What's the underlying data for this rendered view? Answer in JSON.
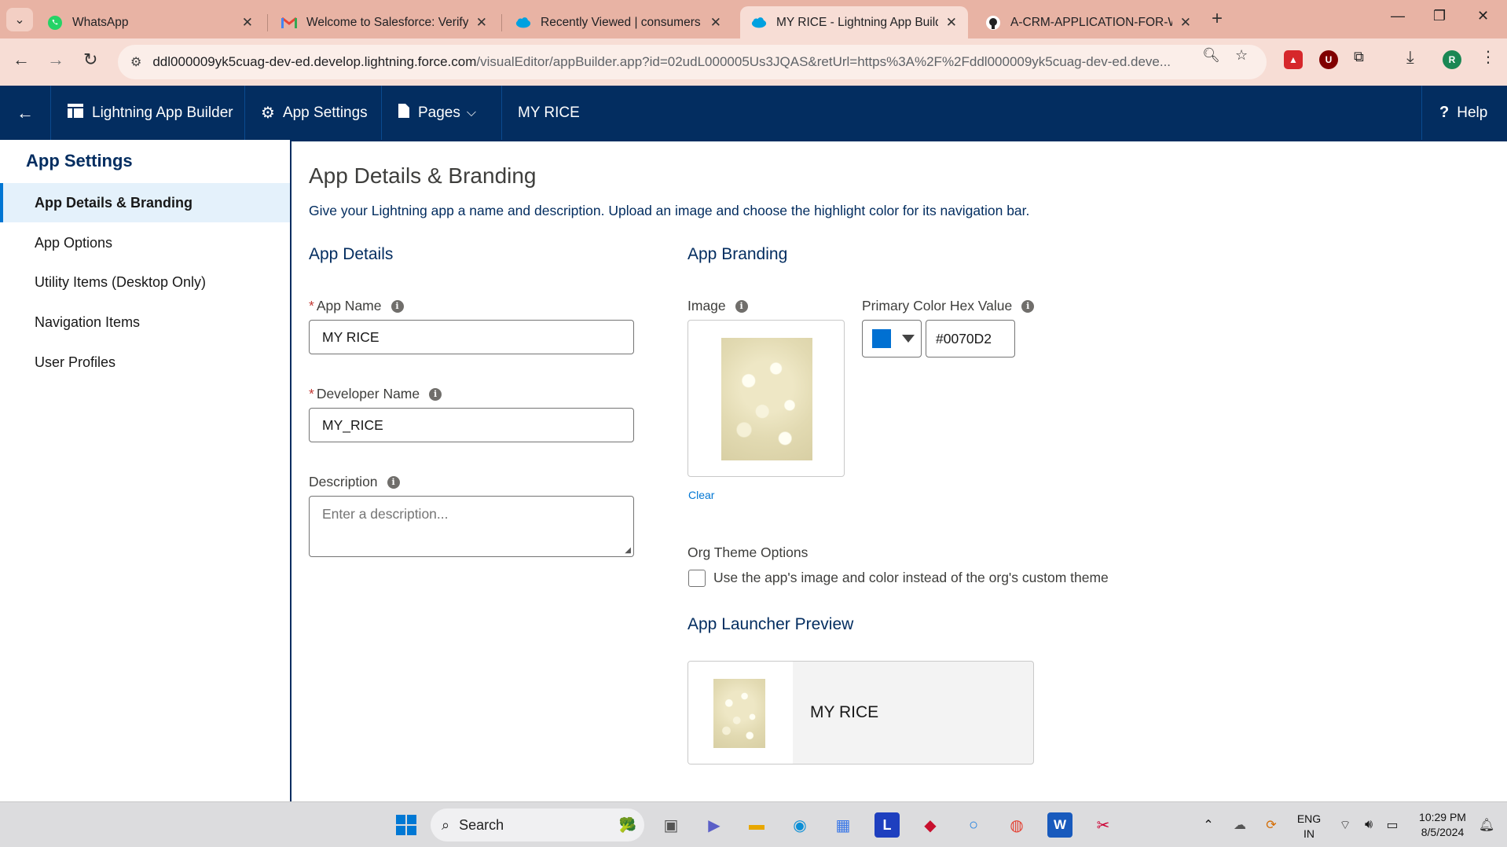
{
  "browser": {
    "tabs": [
      {
        "title": "WhatsApp",
        "icon": "whatsapp-icon",
        "active": false
      },
      {
        "title": "Welcome to Salesforce: Verify y",
        "icon": "gmail-icon",
        "active": false
      },
      {
        "title": "Recently Viewed | consumers | S",
        "icon": "salesforce-cloud-icon",
        "active": false
      },
      {
        "title": "MY RICE - Lightning App Builde",
        "icon": "salesforce-cloud-icon",
        "active": true
      },
      {
        "title": "A-CRM-APPLICATION-FOR-WH",
        "icon": "github-icon",
        "active": false
      }
    ],
    "url_host": "ddl000009yk5cuag-dev-ed.develop.lightning.force.com",
    "url_path": "/visualEditor/appBuilder.app?id=02udL000005Us3JQAS&retUrl=https%3A%2F%2Fddl000009yk5cuag-dev-ed.deve...",
    "profile_initial": "R"
  },
  "header": {
    "builder_label": "Lightning App Builder",
    "app_settings_label": "App Settings",
    "pages_label": "Pages",
    "app_name": "MY RICE",
    "help_label": "Help"
  },
  "sidebar": {
    "title": "App Settings",
    "items": [
      {
        "label": "App Details & Branding",
        "active": true
      },
      {
        "label": "App Options",
        "active": false
      },
      {
        "label": "Utility Items (Desktop Only)",
        "active": false
      },
      {
        "label": "Navigation Items",
        "active": false
      },
      {
        "label": "User Profiles",
        "active": false
      }
    ]
  },
  "main": {
    "title": "App Details & Branding",
    "description": "Give your Lightning app a name and description. Upload an image and choose the highlight color for its navigation bar.",
    "details": {
      "heading": "App Details",
      "app_name_label": "App Name",
      "app_name_value": "MY RICE",
      "developer_name_label": "Developer Name",
      "developer_name_value": "MY_RICE",
      "description_label": "Description",
      "description_placeholder": "Enter a description..."
    },
    "branding": {
      "heading": "App Branding",
      "image_label": "Image",
      "clear_label": "Clear",
      "color_label": "Primary Color Hex Value",
      "color_value": "#0070D2",
      "org_theme_label": "Org Theme Options",
      "org_theme_checkbox_label": "Use the app's image and color instead of the org's custom theme",
      "org_theme_checked": false,
      "preview_heading": "App Launcher Preview",
      "preview_app_name": "MY RICE"
    }
  },
  "taskbar": {
    "search_label": "Search",
    "lang_top": "ENG",
    "lang_bottom": "IN",
    "time": "10:29 PM",
    "date": "8/5/2024"
  },
  "colors": {
    "sf_header": "#032d60",
    "brand_primary": "#0070D2",
    "tab_strip": "#e8b3a4"
  }
}
